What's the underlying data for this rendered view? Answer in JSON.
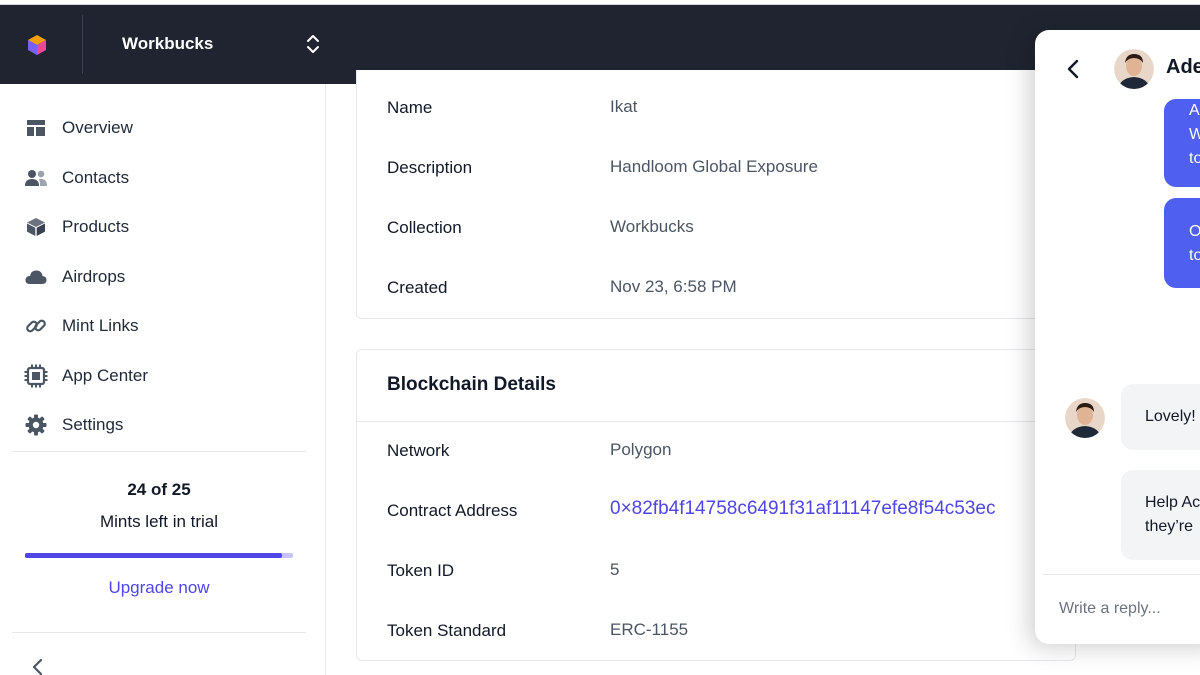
{
  "header": {
    "workspace_name": "Workbucks",
    "icons": [
      "logo-cube-icon",
      "chevron-up-down-icon"
    ]
  },
  "sidebar": {
    "items": [
      {
        "label": "Overview",
        "icon": "layout-icon"
      },
      {
        "label": "Contacts",
        "icon": "users-icon"
      },
      {
        "label": "Products",
        "icon": "cube-icon"
      },
      {
        "label": "Airdrops",
        "icon": "cloud-icon"
      },
      {
        "label": "Mint Links",
        "icon": "link-icon"
      },
      {
        "label": "App Center",
        "icon": "chip-icon"
      },
      {
        "label": "Settings",
        "icon": "gear-icon"
      }
    ],
    "trial": {
      "count": "24 of 25",
      "text": "Mints left in trial",
      "progress_fraction": 0.96,
      "upgrade_label": "Upgrade now"
    }
  },
  "details": {
    "rows": [
      {
        "label": "Name",
        "value": "Ikat"
      },
      {
        "label": "Description",
        "value": "Handloom Global Exposure"
      },
      {
        "label": "Collection",
        "value": "Workbucks"
      },
      {
        "label": "Created",
        "value": "Nov 23, 6:58 PM"
      }
    ]
  },
  "blockchain": {
    "title": "Blockchain Details",
    "rows": [
      {
        "label": "Network",
        "value": "Polygon"
      },
      {
        "label": "Contract Address",
        "value": "0×82fb4f14758c6491f31af11147efe8f54c53ec"
      },
      {
        "label": "Token ID",
        "value": "5"
      },
      {
        "label": "Token Standard",
        "value": "ERC-1155"
      }
    ]
  },
  "chat": {
    "contact_name": "Ade",
    "outgoing": [
      {
        "lines": [
          "A",
          "W",
          "to"
        ]
      },
      {
        "lines": [
          "O",
          "to"
        ]
      }
    ],
    "incoming": [
      {
        "lines": [
          "Lovely!"
        ]
      },
      {
        "lines": [
          "Help Ac",
          "they’re"
        ]
      }
    ],
    "reply_placeholder": "Write a reply..."
  },
  "colors": {
    "topbar": "#1f2430",
    "accent": "#4f46e5",
    "chat_bubble_out": "#4f5ff0",
    "chat_bubble_in": "#f3f4f6"
  }
}
